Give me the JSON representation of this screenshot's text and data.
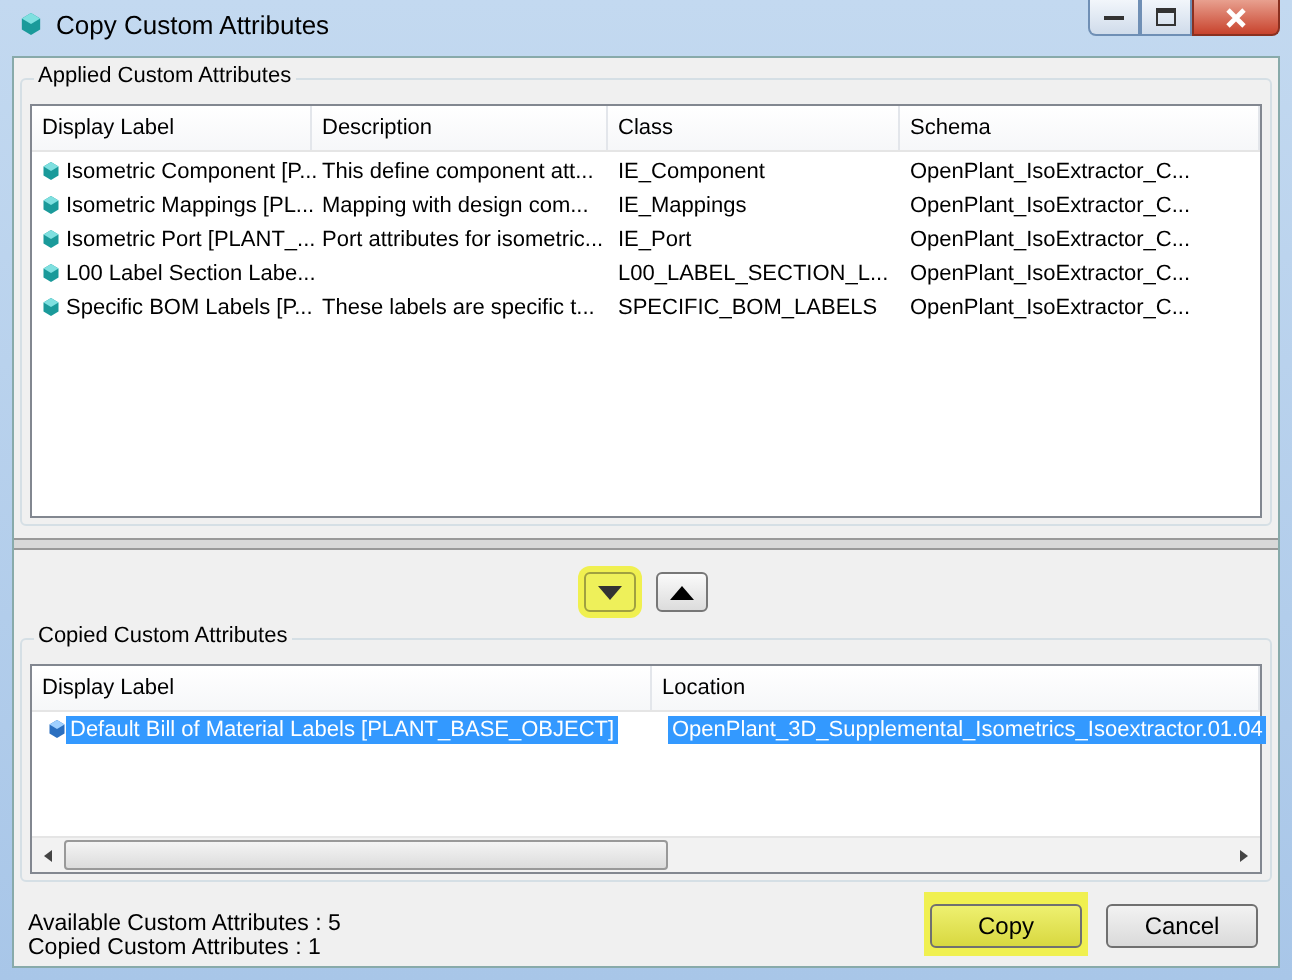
{
  "window": {
    "title": "Copy Custom Attributes"
  },
  "applied": {
    "title": "Applied Custom Attributes",
    "columns": [
      "Display Label",
      "Description",
      "Class",
      "Schema"
    ],
    "rows": [
      {
        "cells": [
          "Isometric Component [P...",
          "This define component att...",
          "IE_Component",
          "OpenPlant_IsoExtractor_C..."
        ],
        "selected": false
      },
      {
        "cells": [
          "Isometric Mappings [PL...",
          "Mapping with design com...",
          "IE_Mappings",
          "OpenPlant_IsoExtractor_C..."
        ],
        "selected": false
      },
      {
        "cells": [
          "Isometric Port [PLANT_...",
          "Port attributes for isometric...",
          "IE_Port",
          "OpenPlant_IsoExtractor_C..."
        ],
        "selected": false
      },
      {
        "cells": [
          "L00 Label Section Labe...",
          "",
          "L00_LABEL_SECTION_L...",
          "OpenPlant_IsoExtractor_C..."
        ],
        "selected": false
      },
      {
        "cells": [
          "Specific BOM Labels [P...",
          "These labels are specific t...",
          "SPECIFIC_BOM_LABELS",
          "OpenPlant_IsoExtractor_C..."
        ],
        "selected": false
      }
    ]
  },
  "move_buttons": [
    {
      "kind": "down",
      "highlighted": true
    },
    {
      "kind": "up",
      "highlighted": false
    }
  ],
  "copied": {
    "title": "Copied Custom Attributes",
    "columns": [
      "Display Label",
      "Location"
    ],
    "rows": [
      {
        "cells": [
          "Default Bill of Material Labels [PLANT_BASE_OBJECT]",
          "OpenPlant_3D_Supplemental_Isometrics_Isoextractor.01.04"
        ],
        "selected": true
      }
    ]
  },
  "status": [
    "Available Custom Attributes : 5",
    "Copied Custom Attributes : 1"
  ],
  "buttons": [
    {
      "label": "Copy",
      "highlighted": true
    },
    {
      "label": "Cancel",
      "highlighted": false
    }
  ]
}
